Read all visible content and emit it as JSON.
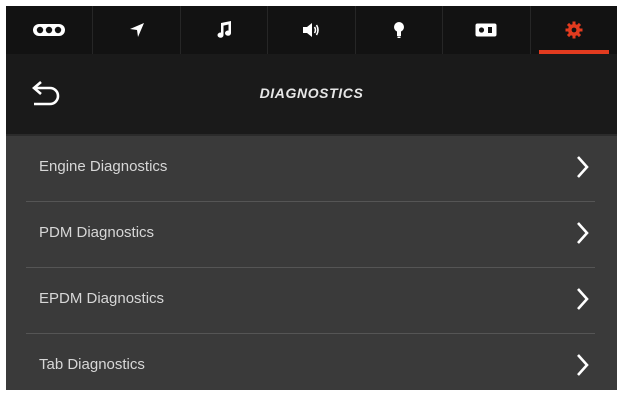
{
  "nav": {
    "tabs": [
      {
        "id": "vehicle",
        "icon": "vehicle-icon"
      },
      {
        "id": "navigation",
        "icon": "navigation-arrow-icon"
      },
      {
        "id": "music",
        "icon": "music-note-icon"
      },
      {
        "id": "volume",
        "icon": "speaker-icon"
      },
      {
        "id": "lights",
        "icon": "bulb-icon"
      },
      {
        "id": "gauges",
        "icon": "display-toggle-icon"
      },
      {
        "id": "settings",
        "icon": "gear-icon",
        "active": true
      }
    ],
    "active_color": "#e23b1f"
  },
  "header": {
    "title": "DIAGNOSTICS",
    "back_icon": "back-arrow-icon"
  },
  "menu": {
    "items": [
      {
        "label": "Engine Diagnostics"
      },
      {
        "label": "PDM Diagnostics"
      },
      {
        "label": "EPDM Diagnostics"
      },
      {
        "label": "Tab Diagnostics"
      }
    ],
    "chevron_icon": "chevron-right-icon"
  }
}
